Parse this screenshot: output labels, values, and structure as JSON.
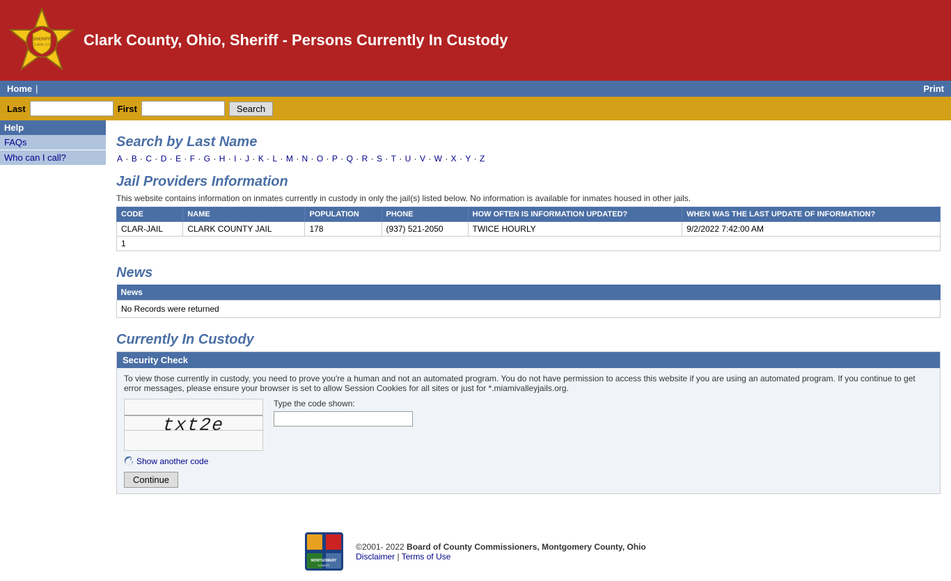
{
  "header": {
    "title": "Clark County, Ohio, Sheriff - Persons Currently In Custody",
    "nav": {
      "home": "Home",
      "print": "Print"
    },
    "search": {
      "last_label": "Last",
      "first_label": "First",
      "button": "Search"
    }
  },
  "sidebar": {
    "section_title": "Help",
    "links": [
      {
        "label": "FAQs",
        "href": "#"
      },
      {
        "label": "Who can I call?",
        "href": "#"
      }
    ]
  },
  "search_section": {
    "heading": "Search by Last Name",
    "alphabet": [
      "A",
      "B",
      "C",
      "D",
      "E",
      "F",
      "G",
      "H",
      "I",
      "J",
      "K",
      "L",
      "M",
      "N",
      "O",
      "P",
      "Q",
      "R",
      "S",
      "T",
      "U",
      "V",
      "W",
      "X",
      "Y",
      "Z"
    ]
  },
  "jail_providers": {
    "heading": "Jail Providers Information",
    "description": "This website contains information on inmates currently in custody in only the jail(s) listed below. No information is available for inmates housed in other jails.",
    "columns": [
      "CODE",
      "NAME",
      "POPULATION",
      "PHONE",
      "HOW OFTEN IS INFORMATION UPDATED?",
      "WHEN WAS THE LAST UPDATE OF INFORMATION?"
    ],
    "rows": [
      {
        "code": "CLAR-JAIL",
        "name": "CLARK COUNTY JAIL",
        "population": "178",
        "phone": "(937) 521-2050",
        "update_freq": "TWICE HOURLY",
        "last_update": "9/2/2022 7:42:00 AM"
      }
    ],
    "row_count": "1"
  },
  "news": {
    "heading": "News",
    "column": "News",
    "no_records": "No Records were returned"
  },
  "custody": {
    "heading": "Currently In Custody",
    "security_check": {
      "header": "Security Check",
      "body": "To view those currently in custody, you need to prove you're a human and not an automated program. You do not have permission to access this website if you are using an automated program. If you continue to get error messages, please ensure your browser is set to allow Session Cookies for all sites or just for *.miamivalleyjails.org.",
      "captcha_label": "Type the code shown:",
      "captcha_text": "txt2e",
      "show_another": "Show another code",
      "continue_button": "Continue"
    }
  },
  "footer": {
    "copyright": "©2001- 2022",
    "org": "Board of County Commissioners, Montgomery County, Ohio",
    "disclaimer": "Disclaimer",
    "terms": "Terms of Use"
  }
}
